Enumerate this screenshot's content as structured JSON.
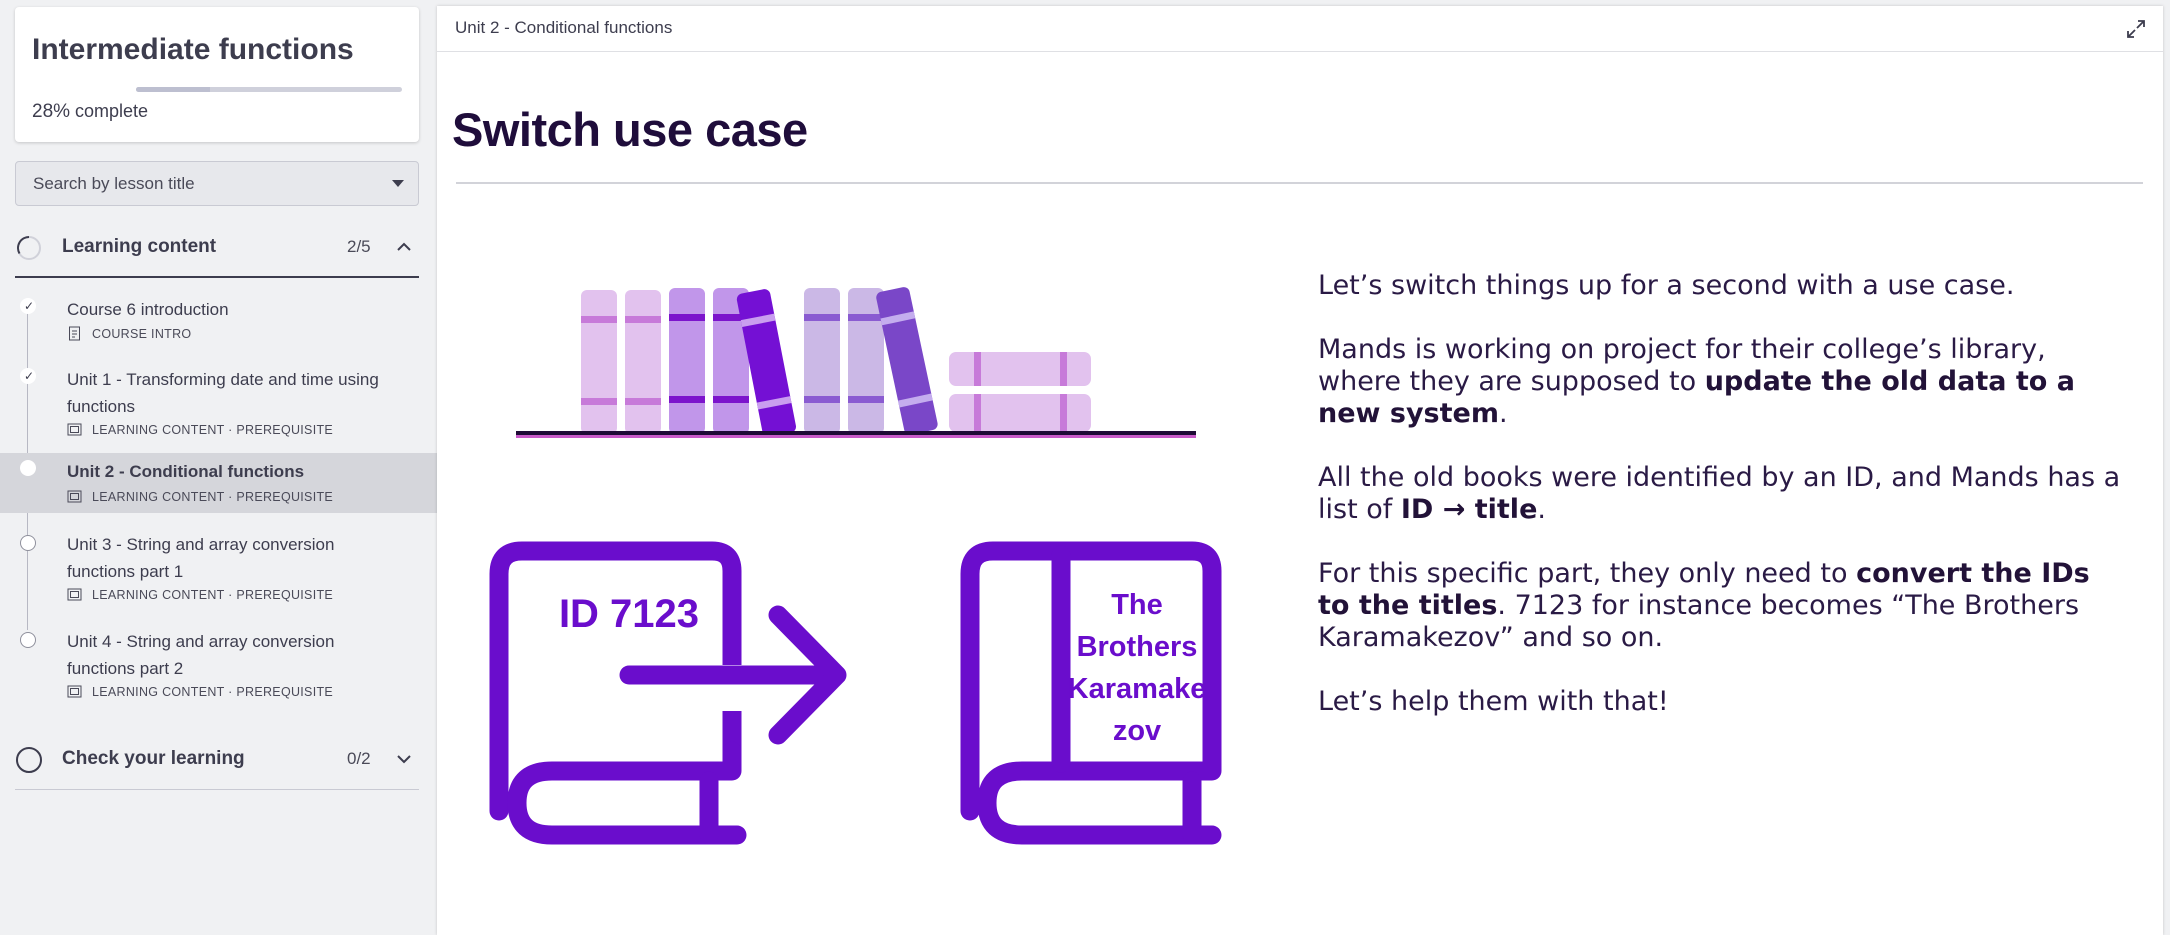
{
  "course": {
    "title": "Intermediate functions",
    "progress_pct": "28%",
    "progress_suffix": " complete",
    "progress_value": 0.28
  },
  "search": {
    "placeholder": "Search by lesson title"
  },
  "sections": {
    "learning": {
      "title": "Learning content",
      "count": "2/5"
    },
    "check": {
      "title": "Check your learning",
      "count": "0/2"
    }
  },
  "lessons": [
    {
      "title": "Course 6 introduction",
      "meta": "COURSE INTRO",
      "state": "done"
    },
    {
      "title": "Unit 1 - Transforming date and time using functions",
      "meta": "LEARNING CONTENT · PREREQUISITE",
      "state": "done"
    },
    {
      "title": "Unit 2 - Conditional functions",
      "meta": "LEARNING CONTENT · PREREQUISITE",
      "state": "current"
    },
    {
      "title": "Unit 3 - String and array conversion functions part 1",
      "meta": "LEARNING CONTENT · PREREQUISITE",
      "state": "todo"
    },
    {
      "title": "Unit 4 - String and array conversion functions part 2",
      "meta": "LEARNING CONTENT · PREREQUISITE",
      "state": "todo"
    }
  ],
  "main": {
    "unit_title": "Unit 2 - Conditional functions",
    "page_title": "Switch use case",
    "illustration": {
      "id_label": "ID 7123",
      "book_title_lines": [
        "The",
        "Brothers",
        "Karamake",
        "zov"
      ]
    },
    "paragraphs": {
      "p1": "Let’s switch things up for a second with a use case.",
      "p2_a": "Mands is working on project for their college’s library, where they are supposed to ",
      "p2_b": "update the old data to a new system",
      "p2_c": ".",
      "p3_a": "All the old books were identified by an ID, and Mands has a list of ",
      "p3_b": "ID → title",
      "p3_c": ".",
      "p4_a": "For this specific part, they only need to ",
      "p4_b": "convert the IDs to the titles",
      "p4_c": ". 7123 for instance becomes “The Brothers Karamakezov” and so on.",
      "p5": "Let’s help them with that!"
    }
  },
  "colors": {
    "accent_purple": "#6a0dcc",
    "title_navy": "#1f0d3b"
  }
}
